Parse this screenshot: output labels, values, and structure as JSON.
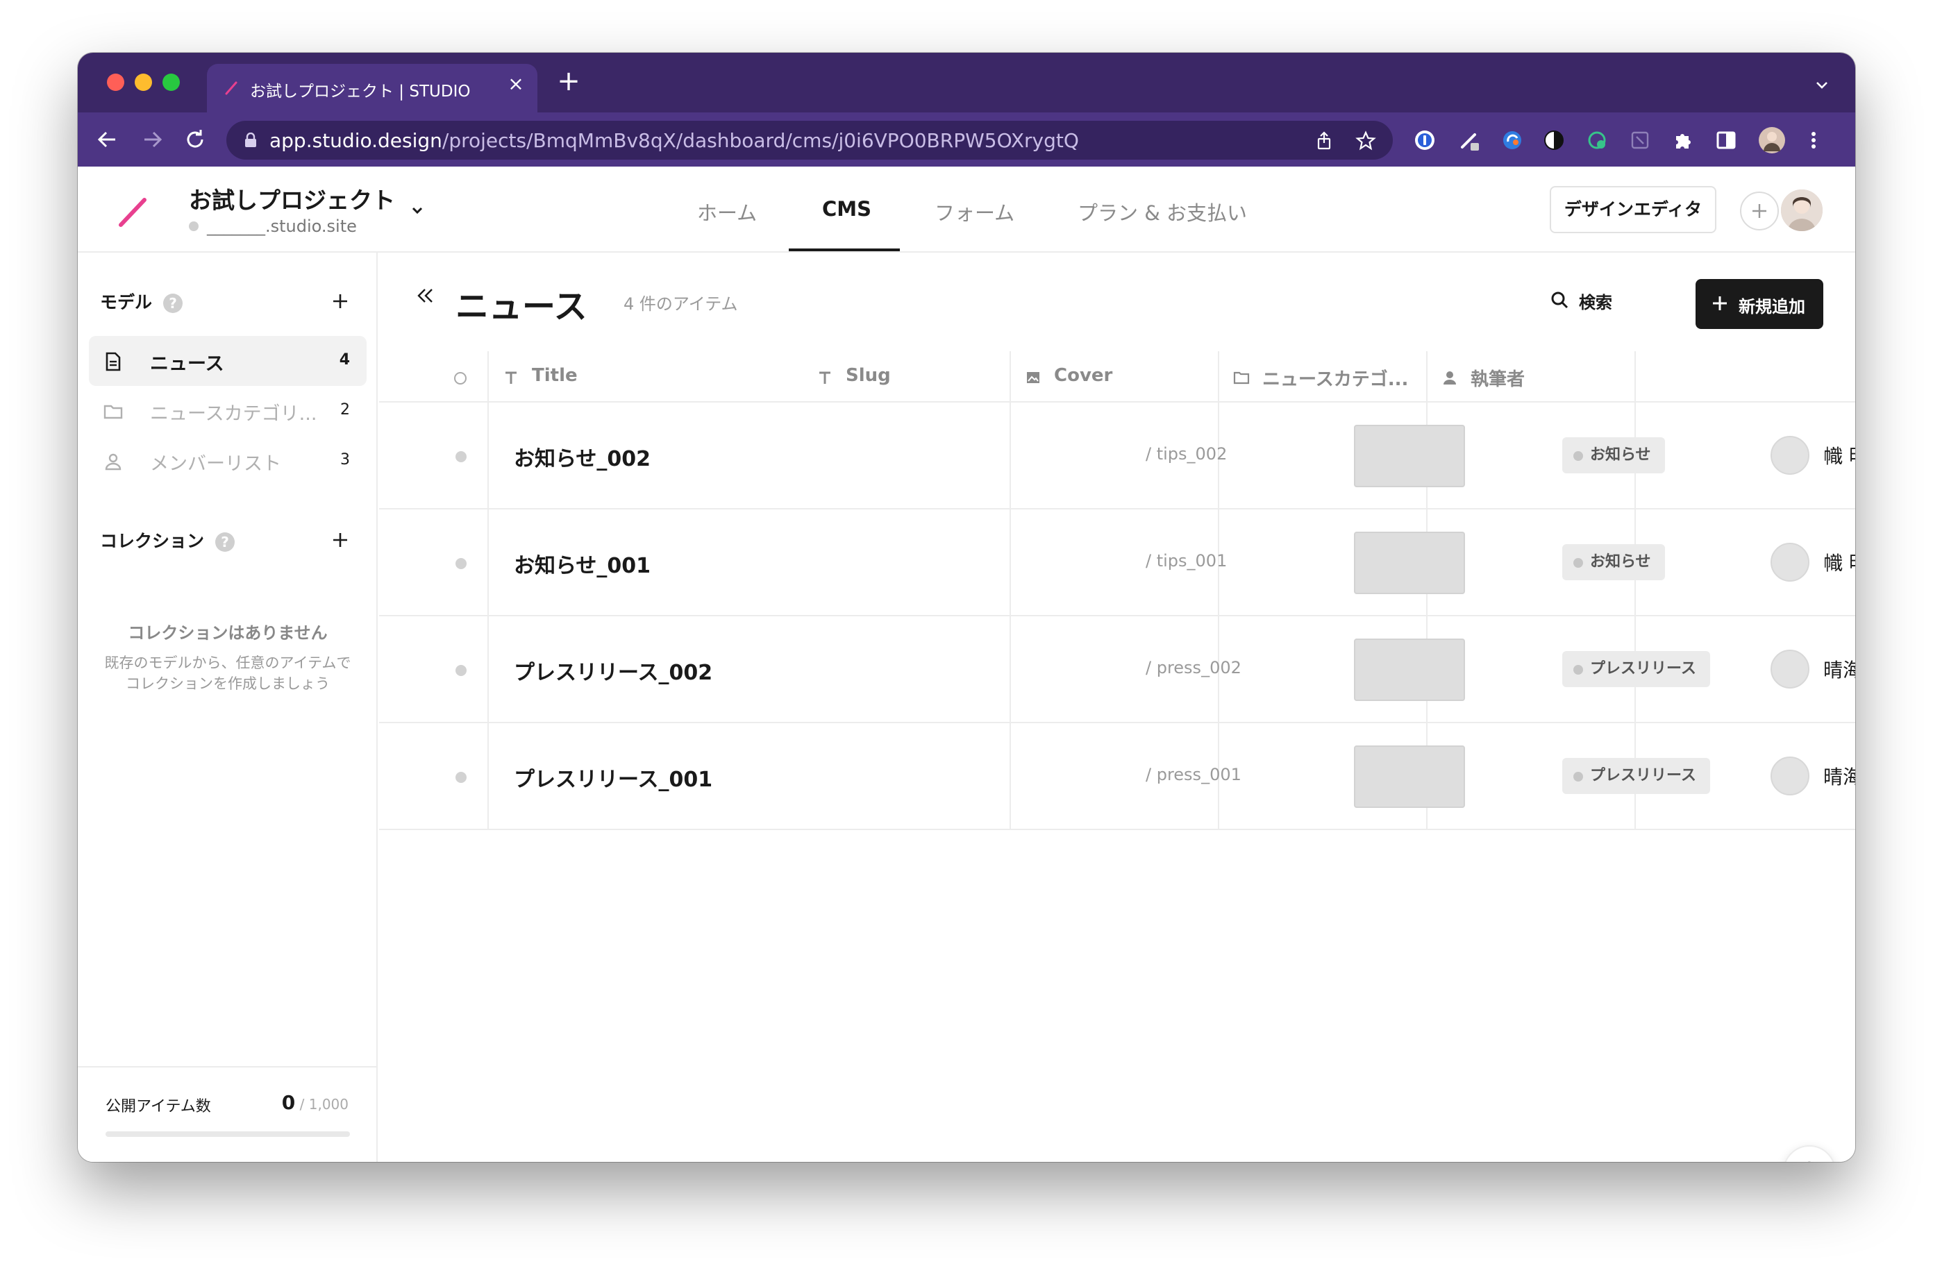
{
  "browser": {
    "tab_title": "お試しプロジェクト | STUDIO",
    "new_tab_label": "+",
    "close_label": "×",
    "url_host": "app.studio.design",
    "url_path": "/projects/BmqMmBv8qX/dashboard/cms/j0i6VPO0BRPW5OXrygtQ"
  },
  "header": {
    "project_name": "お試しプロジェクト",
    "project_site": "_______.studio.site",
    "nav": [
      "ホーム",
      "CMS",
      "フォーム",
      "プラン & お支払い"
    ],
    "active_nav": "CMS",
    "design_editor_label": "デザインエディタ",
    "accent_color": "#e8408f"
  },
  "sidebar": {
    "models_title": "モデル",
    "help_label": "?",
    "models": [
      {
        "label": "ニュース",
        "count": "4",
        "icon": "document-icon",
        "active": true
      },
      {
        "label": "ニュースカテゴリ...",
        "count": "2",
        "icon": "folder-icon",
        "active": false
      },
      {
        "label": "メンバーリスト",
        "count": "3",
        "icon": "person-icon",
        "active": false
      }
    ],
    "collections_title": "コレクション",
    "empty_title": "コレクションはありません",
    "empty_desc_1": "既存のモデルから、任意のアイテムで",
    "empty_desc_2": "コレクションを作成しましょう",
    "published_label": "公開アイテム数",
    "published_value": "0",
    "published_max": " / 1,000",
    "published_fraction": 0
  },
  "main": {
    "title": "ニュース",
    "item_count": "4 件のアイテム",
    "search_label": "検索",
    "new_label": "新規追加",
    "columns": [
      {
        "label": "Title",
        "icon": "text-type-icon"
      },
      {
        "label": "Slug",
        "icon": "text-type-icon"
      },
      {
        "label": "Cover",
        "icon": "image-icon"
      },
      {
        "label": "ニュースカテゴ...",
        "icon": "folder-icon"
      },
      {
        "label": "執筆者",
        "icon": "person-icon"
      }
    ],
    "rows": [
      {
        "title": "お知らせ_002",
        "slug": "/  tips_002",
        "category": "お知らせ",
        "author": "幟 明日夏 /..."
      },
      {
        "title": "お知らせ_001",
        "slug": "/  tips_001",
        "category": "お知らせ",
        "author": "幟 明日夏 /..."
      },
      {
        "title": "プレスリリース_002",
        "slug": "/  press_002",
        "category": "プレスリリース",
        "author": "晴海 礼 / H..."
      },
      {
        "title": "プレスリリース_001",
        "slug": "/  press_001",
        "category": "プレスリリース",
        "author": "晴海 礼 / H..."
      }
    ],
    "help_fab_label": "?"
  }
}
